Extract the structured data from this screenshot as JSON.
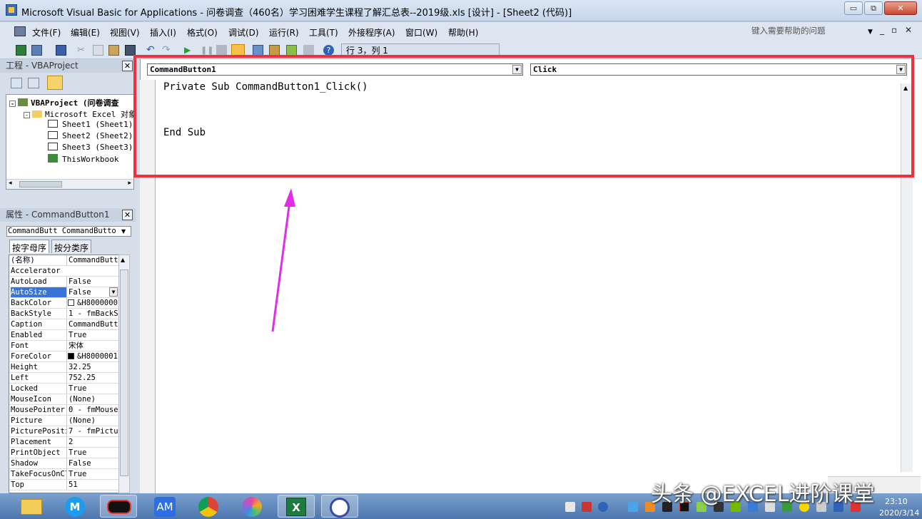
{
  "window": {
    "title": "Microsoft Visual Basic for Applications - 问卷调查（460名）学习困难学生课程了解汇总表--2019级.xls [设计] - [Sheet2 (代码)]",
    "min_label": "▭",
    "restore_label": "⧉",
    "close_label": "✕"
  },
  "menubar": {
    "items": [
      "文件(F)",
      "编辑(E)",
      "视图(V)",
      "插入(I)",
      "格式(O)",
      "调试(D)",
      "运行(R)",
      "工具(T)",
      "外接程序(A)",
      "窗口(W)",
      "帮助(H)"
    ],
    "help_placeholder": "键入需要帮助的问题",
    "mdi_min": "_",
    "mdi_restore": "▫",
    "mdi_close": "✕"
  },
  "toolbar": {
    "position_text": "行 3，列 1"
  },
  "project": {
    "title": "工程 - VBAProject",
    "close": "✕",
    "tree": [
      {
        "label": "VBAProject (问卷调查",
        "level": 0
      },
      {
        "label": "Microsoft Excel 对象",
        "level": 1
      },
      {
        "label": "Sheet1 (Sheet1)",
        "level": 2
      },
      {
        "label": "Sheet2 (Sheet2)",
        "level": 2
      },
      {
        "label": "Sheet3 (Sheet3)",
        "level": 2
      },
      {
        "label": "ThisWorkbook",
        "level": 2
      }
    ]
  },
  "properties": {
    "title": "属性 - CommandButton1",
    "close": "✕",
    "object_combo": "CommandButt CommandButto",
    "tabs": [
      "按字母序",
      "按分类序"
    ],
    "rows": [
      {
        "name": "(名称)",
        "value": "CommandButto"
      },
      {
        "name": "Accelerator",
        "value": ""
      },
      {
        "name": "AutoLoad",
        "value": "False"
      },
      {
        "name": "AutoSize",
        "value": "False"
      },
      {
        "name": "BackColor",
        "value": "&H8000000"
      },
      {
        "name": "BackStyle",
        "value": "1 - fmBackSt"
      },
      {
        "name": "Caption",
        "value": "CommandButto"
      },
      {
        "name": "Enabled",
        "value": "True"
      },
      {
        "name": "Font",
        "value": "宋体"
      },
      {
        "name": "ForeColor",
        "value": "&H8000001"
      },
      {
        "name": "Height",
        "value": "32.25"
      },
      {
        "name": "Left",
        "value": "752.25"
      },
      {
        "name": "Locked",
        "value": "True"
      },
      {
        "name": "MouseIcon",
        "value": "(None)"
      },
      {
        "name": "MousePointer",
        "value": "0 - fmMouseP"
      },
      {
        "name": "Picture",
        "value": "(None)"
      },
      {
        "name": "PicturePosition",
        "value": "7 - fmPictur"
      },
      {
        "name": "Placement",
        "value": "2"
      },
      {
        "name": "PrintObject",
        "value": "True"
      },
      {
        "name": "Shadow",
        "value": "False"
      },
      {
        "name": "TakeFocusOnClick",
        "value": "True"
      },
      {
        "name": "Top",
        "value": "51"
      }
    ]
  },
  "code": {
    "object_combo": "CommandButton1",
    "proc_combo": "Click",
    "lines": [
      "Private Sub CommandButton1_Click()",
      "",
      "",
      "End Sub"
    ]
  },
  "taskbar": {
    "watermark": "头条 @EXCEL进阶课堂",
    "time": "23:10",
    "date": "2020/3/14"
  },
  "colors": {
    "highlight": "#f0303c",
    "arrow": "#e22ce8",
    "selection": "#3874d8"
  }
}
